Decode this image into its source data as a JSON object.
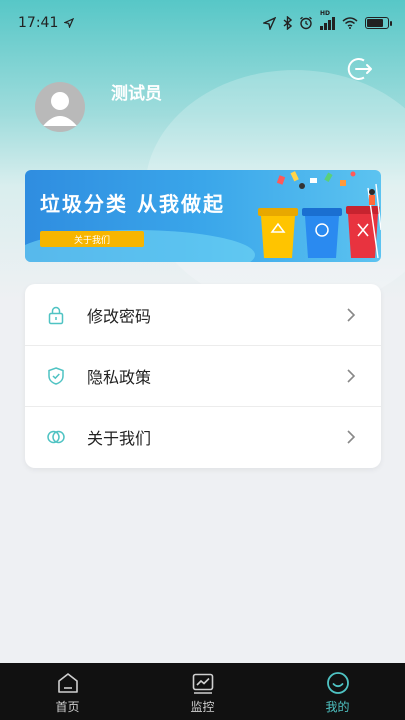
{
  "status_bar": {
    "time": "17:41",
    "network_label": "HD"
  },
  "profile": {
    "username": "测试员"
  },
  "banner": {
    "title": "垃圾分类  从我做起",
    "button_label": "关于我们"
  },
  "menu": {
    "items": [
      {
        "label": "修改密码",
        "icon": "lock-icon"
      },
      {
        "label": "隐私政策",
        "icon": "shield-icon"
      },
      {
        "label": "关于我们",
        "icon": "circles-icon"
      }
    ]
  },
  "tab_bar": {
    "tabs": [
      {
        "label": "首页",
        "icon": "home-icon"
      },
      {
        "label": "监控",
        "icon": "chart-icon"
      },
      {
        "label": "我的",
        "icon": "smile-icon"
      }
    ],
    "active_index": 2
  },
  "colors": {
    "accent": "#4fc3c3",
    "header_top": "#57c7c7",
    "banner_button": "#f7b500",
    "tab_bar_bg": "#111111"
  }
}
